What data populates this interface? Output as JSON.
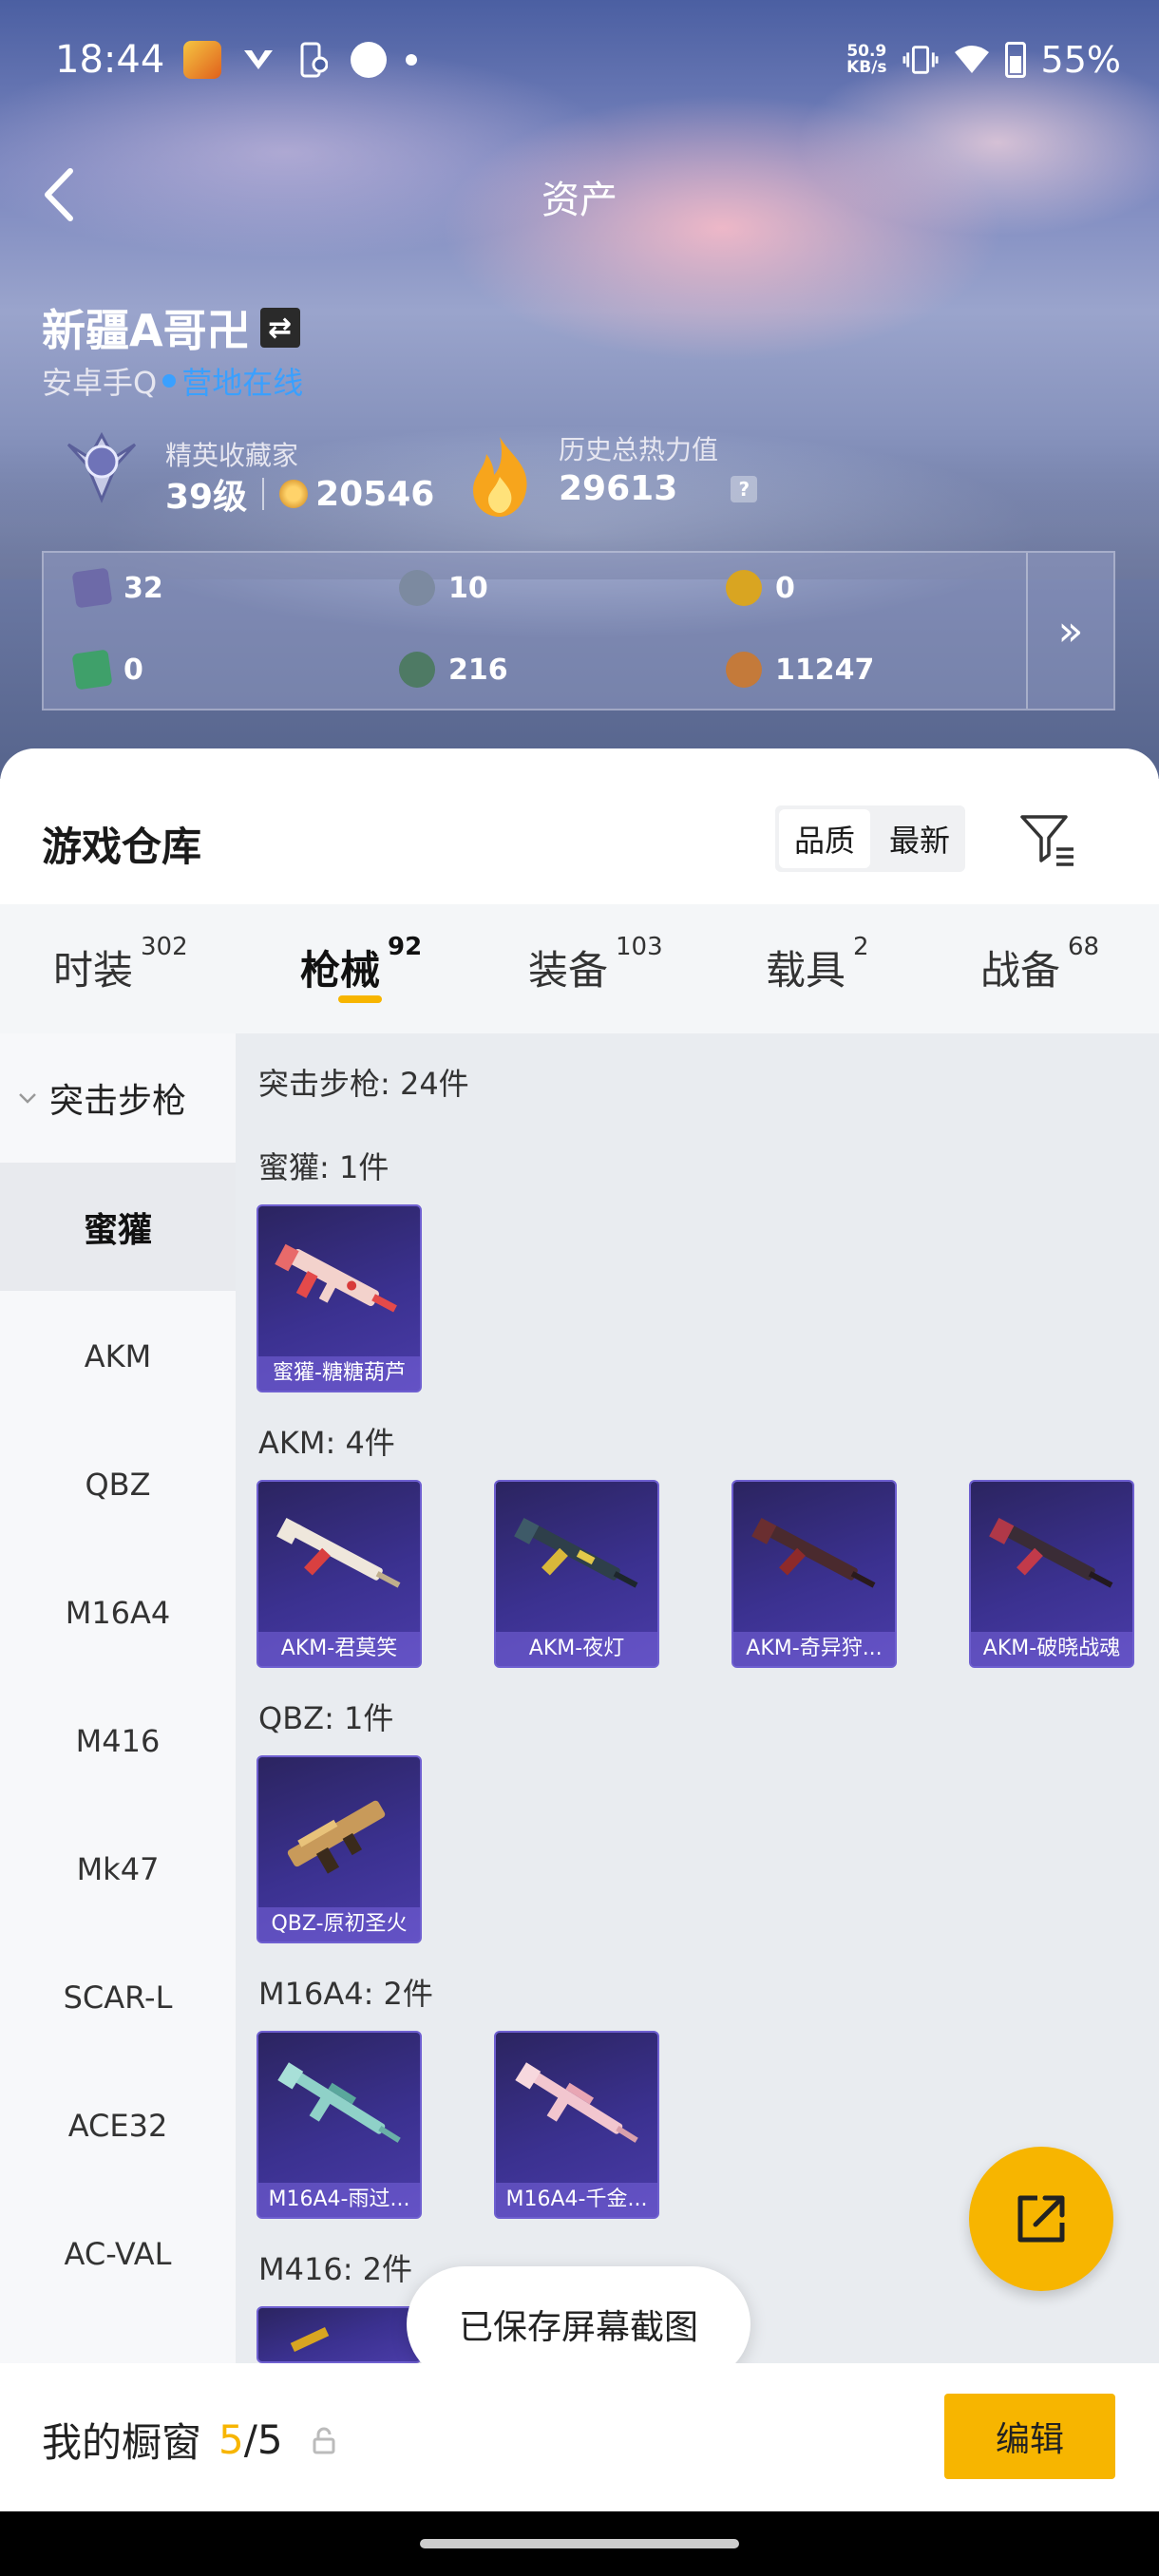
{
  "status_bar": {
    "time": "18:44",
    "net_speed_top": "50.9",
    "net_speed_unit": "KB/s",
    "battery": "55%"
  },
  "header": {
    "title": "资产",
    "back_icon": "chevron-left-icon"
  },
  "profile": {
    "name": "新疆A哥卍",
    "platform": "安卓手Q",
    "online_status": "营地在线",
    "rank_label": "精英收藏家",
    "level": "39级",
    "score": "20546",
    "heat_label": "历史总热力值",
    "heat_value": "29613",
    "help_mark": "?"
  },
  "resources": [
    {
      "icon": "card-icon",
      "value": "32",
      "color": "#6d6aa8"
    },
    {
      "icon": "silver-coin-icon",
      "value": "10",
      "color": "#7c8aa0"
    },
    {
      "icon": "gold-token-icon",
      "value": "0",
      "color": "#d9a521"
    },
    {
      "icon": "green-card-icon",
      "value": "0",
      "color": "#3fa06a"
    },
    {
      "icon": "orb-icon",
      "value": "216",
      "color": "#4e7a64"
    },
    {
      "icon": "bronze-coin-icon",
      "value": "11247",
      "color": "#c47a3a"
    }
  ],
  "warehouse": {
    "title": "游戏仓库",
    "sort_options": [
      "品质",
      "最新"
    ]
  },
  "tabs": [
    {
      "label": "时装",
      "count": "302"
    },
    {
      "label": "枪械",
      "count": "92"
    },
    {
      "label": "装备",
      "count": "103"
    },
    {
      "label": "载具",
      "count": "2"
    },
    {
      "label": "战备",
      "count": "68"
    }
  ],
  "sidebar": {
    "header": "突击步枪",
    "items": [
      "蜜獾",
      "AKM",
      "QBZ",
      "M16A4",
      "M416",
      "Mk47",
      "SCAR-L",
      "ACE32",
      "AC-VAL"
    ]
  },
  "content": {
    "section_total": "突击步枪: 24件",
    "groups": [
      {
        "header": "蜜獾: 1件",
        "items": [
          "蜜獾-糖糖葫芦"
        ]
      },
      {
        "header": "AKM: 4件",
        "items": [
          "AKM-君莫笑",
          "AKM-夜灯",
          "AKM-奇异狩...",
          "AKM-破晓战魂"
        ]
      },
      {
        "header": "QBZ: 1件",
        "items": [
          "QBZ-原初圣火"
        ]
      },
      {
        "header": "M16A4: 2件",
        "items": [
          "M16A4-雨过...",
          "M16A4-千金..."
        ]
      },
      {
        "header": "M416: 2件",
        "items": []
      }
    ]
  },
  "toast": "已保存屏幕截图",
  "showcase": {
    "label": "我的橱窗",
    "current": "5",
    "total": "/5",
    "edit_label": "编辑"
  },
  "colors": {
    "accent": "#f7b500",
    "online": "#3aa0ff",
    "card_border": "#6e5fd0"
  }
}
